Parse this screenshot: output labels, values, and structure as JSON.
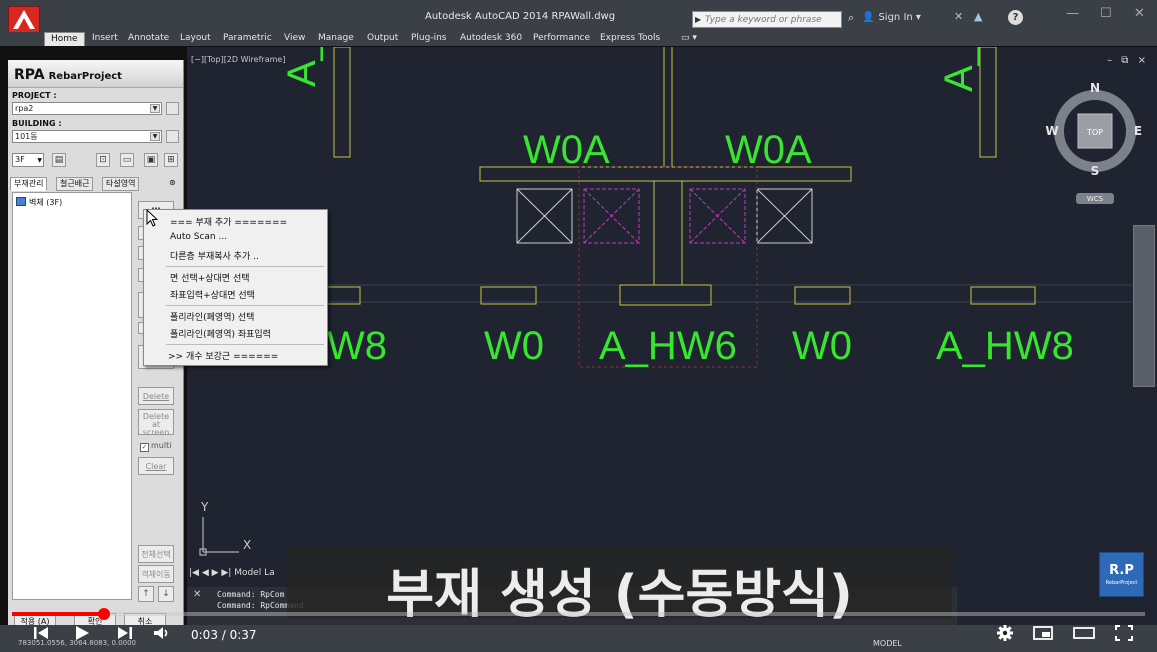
{
  "window": {
    "title": "Autodesk AutoCAD 2014    RPAWall.dwg",
    "search_placeholder": "Type a keyword or phrase",
    "sign_in": "Sign In"
  },
  "ribbon": {
    "tabs": [
      {
        "label": "Home"
      },
      {
        "label": "Insert"
      },
      {
        "label": "Annotate"
      },
      {
        "label": "Layout"
      },
      {
        "label": "Parametric"
      },
      {
        "label": "View"
      },
      {
        "label": "Manage"
      },
      {
        "label": "Output"
      },
      {
        "label": "Plug-ins"
      },
      {
        "label": "Autodesk 360"
      },
      {
        "label": "Performance"
      },
      {
        "label": "Express Tools"
      }
    ]
  },
  "panel": {
    "title": "RPA",
    "subtitle": "RebarProject",
    "project_label": "PROJECT :",
    "project_value": "rpa2",
    "building_label": "BUILDING :",
    "building_value": "101동",
    "floor_value": "3F",
    "tabs": [
      {
        "label": "부재관리"
      },
      {
        "label": "철근배근"
      },
      {
        "label": "타설영역"
      }
    ],
    "tree_item": "벽체 (3F)",
    "buttons": {
      "dots": "...",
      "delete": "Delete",
      "delete_at_screen_1": "Delete",
      "delete_at_screen_2": "at screen",
      "multi": "multi",
      "clear": "Clear",
      "select_all": "전체선택",
      "unselect": "객체이동",
      "up": "↑",
      "down": "↓",
      "apply": "적용 (A)",
      "ok": "확인",
      "cancel": "취소"
    }
  },
  "context_menu": {
    "items": [
      {
        "label": "=== 부재 추가 ======="
      },
      {
        "label": "Auto Scan ..."
      },
      {
        "label": "다른층 부재복사 추가 .."
      },
      {
        "label": "면 선택+상대면 선택"
      },
      {
        "label": "좌표입력+상대면 선택"
      },
      {
        "label": "폴리라인(폐영역) 선택"
      },
      {
        "label": "폴리라인(폐영역) 좌표입력"
      },
      {
        "label": ">> 개수 보강근    ======"
      }
    ]
  },
  "viewport": {
    "label": "[−][Top][2D Wireframe]",
    "window_controls": "– ⧉ ×",
    "compass": {
      "n": "N",
      "s": "S",
      "e": "E",
      "w": "W",
      "top": "TOP",
      "wcs": "WCS"
    },
    "ucs_y": "Y",
    "ucs_x": "X",
    "labels": {
      "a_left": "A_",
      "a_right": "A_",
      "w0a_1": "W0A",
      "w0a_2": "W0A",
      "w8": "W8",
      "w0_1": "W0",
      "a_hw6": "A_HW6",
      "w0_2": "W0",
      "a_hw8": "A_HW8"
    },
    "model_tabs": "|◀ ◀ ▶ ▶|  Model  La",
    "command_lines": [
      "Command: RpCom",
      "Command: RpCommand"
    ]
  },
  "status": {
    "coords": "783051.0556, 3064.8083, 0.0000",
    "model": "MODEL"
  },
  "video": {
    "subtitle": "부재 생성 (수동방식)",
    "time": "0:03 / 0:37",
    "progress": 0.081,
    "logo": "R.P",
    "logo_sub": "RebarProject"
  },
  "colors": {
    "accent_red": "#ff0000",
    "cad_green": "#38e630",
    "cad_yellow": "#c8c14a",
    "cad_magenta": "#c03bc0",
    "viewport_bg": "#1f2430"
  }
}
